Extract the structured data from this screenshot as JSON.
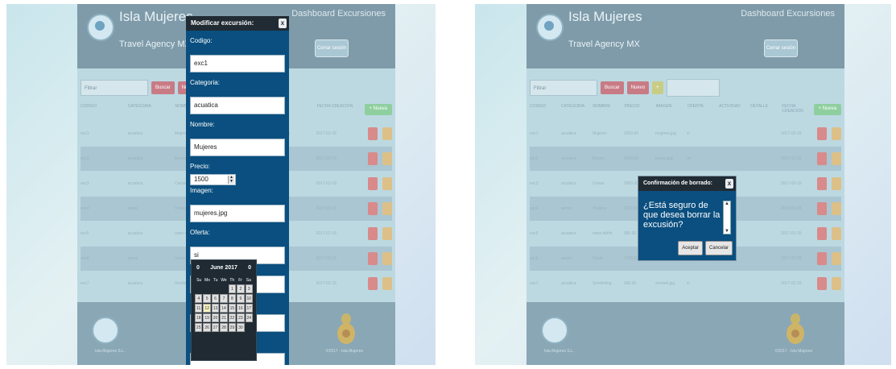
{
  "site": {
    "brand_title": "Isla Mujeres",
    "brand_sub": "Travel Agency MX",
    "dashboard": "Dashboard Excursiones",
    "header_button": "Cerrar sesión",
    "filter_select": "Filtrar",
    "filter_btn_1": "Buscar",
    "filter_btn_2": "Nuevo",
    "add_button": "+ Nueva",
    "columns": [
      "CODIGO",
      "CATEGORIA",
      "NOMBRE",
      "PRECIO",
      "IMAGEN",
      "OFERTA",
      "ACTIVIDAD",
      "DETALLE",
      "FECHA CREACION"
    ],
    "footer_left": "Isla Mujeres S.L.",
    "footer_right": "©2017 - Isla Mujeres"
  },
  "rows": [
    {
      "c": "exc1",
      "cat": "acuatica",
      "nom": "Mujeres",
      "pre": "1500.00",
      "img": "mujeres.jpg",
      "of": "si",
      "fecha": "2017-02-15"
    },
    {
      "c": "exc2",
      "cat": "acuatica",
      "nom": "Buceo",
      "pre": "2400.00",
      "img": "buceo.jpg",
      "of": "no",
      "fecha": "2017-02-15"
    },
    {
      "c": "exc3",
      "cat": "acuatica",
      "nom": "Cenas",
      "pre": "2500.00",
      "img": "cenas.jpg",
      "of": "si",
      "fecha": "2017-02-15"
    },
    {
      "c": "exc4",
      "cat": "aereo",
      "nom": "Tirolesa",
      "pre": "1700.00",
      "img": "tirolesa.jpg",
      "of": "no",
      "fecha": "2017-02-15"
    },
    {
      "c": "exc5",
      "cat": "acuatica",
      "nom": "nado delfin",
      "pre": "950.00",
      "img": "delfin.jpg",
      "of": "si",
      "fecha": "2017-02-15"
    },
    {
      "c": "exc6",
      "cat": "aereo",
      "nom": "Vuelo",
      "pre": "1700.00",
      "img": "vuelo.jpg",
      "of": "no",
      "fecha": "2017-02-15"
    },
    {
      "c": "exc7",
      "cat": "acuatica",
      "nom": "Snorkeling",
      "pre": "900.00",
      "img": "snorkel.jpg",
      "of": "si",
      "fecha": "2017-02-15"
    }
  ],
  "edit_modal": {
    "title": "Modificar excursión:",
    "close": "x",
    "labels": {
      "codigo": "Codigo:",
      "categoria": "Categoria:",
      "nombre": "Nombre:",
      "precio": "Precio:",
      "imagen": "Imagen:",
      "oferta": "Oferta:"
    },
    "values": {
      "codigo": "exc1",
      "categoria": "acuatica",
      "nombre": "Mujeres",
      "precio": "1500",
      "imagen": "mujeres.jpg",
      "oferta": "si"
    }
  },
  "datepicker": {
    "prev": "0",
    "next": "0",
    "month": "June 2017",
    "weekdays": [
      "Su",
      "Mo",
      "Tu",
      "We",
      "Th",
      "Fr",
      "Sa"
    ],
    "today": "12"
  },
  "delete_modal": {
    "title": "Confirmación de borrado:",
    "close": "x",
    "message": "¿Está seguro de que desea borrar la excusión?",
    "accept": "Aceptar",
    "cancel": "Cancelar"
  }
}
